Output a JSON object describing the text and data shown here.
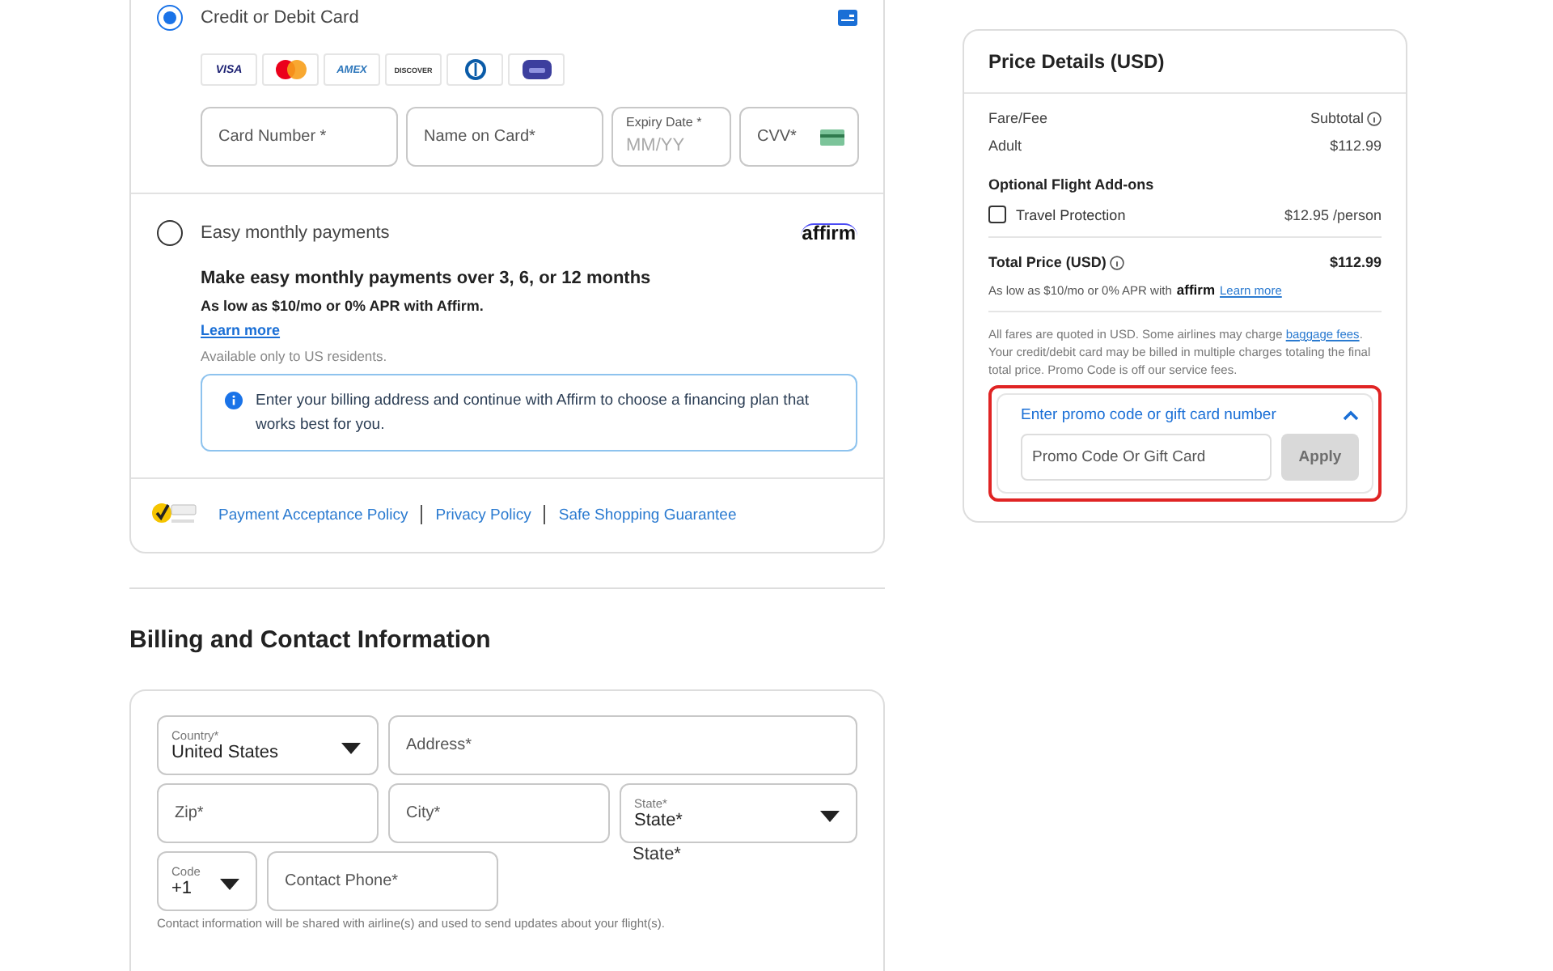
{
  "payment": {
    "methods": [
      {
        "kind": "card",
        "label": "Credit or Debit Card",
        "selected": true,
        "brands": [
          {
            "kind": "visa",
            "text": "VISA"
          },
          {
            "kind": "mastercard"
          },
          {
            "kind": "amex",
            "text": "AMEX"
          },
          {
            "kind": "discover",
            "text": "DISCOVER"
          },
          {
            "kind": "diners"
          },
          {
            "kind": "generic"
          }
        ],
        "fields": [
          {
            "kind": "plain",
            "placeholder": "Card Number *"
          },
          {
            "kind": "plain",
            "placeholder": "Name on Card*"
          },
          {
            "kind": "labeled",
            "label": "Expiry Date *",
            "placeholder": "MM/YY"
          },
          {
            "kind": "cvv",
            "placeholder": "CVV*"
          }
        ]
      },
      {
        "kind": "affirm",
        "label": "Easy monthly payments",
        "selected": false,
        "logo_text": "affirm",
        "heading": "Make easy monthly payments over 3, 6, or 12 months",
        "offer": "As low as **$10**/mo or 0% APR with Affirm.",
        "link": "Learn more",
        "note": "Available only to US residents.",
        "info": "Enter your billing address and continue with Affirm to choose a financing plan that works best for you."
      }
    ],
    "footer_links": [
      "Payment Acceptance Policy",
      "Privacy Policy",
      "Safe Shopping Guarantee"
    ]
  },
  "billing": {
    "title": "Billing and Contact Information",
    "rows": [
      [
        {
          "kind": "select",
          "label": "Country*",
          "value": "United States"
        },
        {
          "kind": "input",
          "placeholder": "Address*"
        }
      ],
      [
        {
          "kind": "input",
          "placeholder": "Zip*"
        },
        {
          "kind": "input",
          "placeholder": "City*"
        },
        {
          "kind": "select",
          "label": "State*",
          "value": "State*",
          "echo": "State*"
        }
      ],
      [
        {
          "kind": "select",
          "label": "Code",
          "value": "+1"
        },
        {
          "kind": "input",
          "placeholder": "Contact Phone*"
        }
      ]
    ],
    "note": "Contact information will be shared with airline(s) and used to send updates about your flight(s)."
  },
  "price": {
    "title": "Price Details (USD)",
    "header": {
      "label": "Fare/Fee",
      "value": "Subtotal"
    },
    "rows": [
      {
        "label": "Adult",
        "value": "$112.99"
      }
    ],
    "addons_title": "Optional Flight Add-ons",
    "addons": [
      {
        "label": "Travel Protection",
        "checked": false,
        "price": "$12.95 /person"
      }
    ],
    "total": {
      "label": "Total Price (USD)",
      "value": "$112.99"
    },
    "affirm_line": {
      "before": "As low as $10/mo or 0% APR with",
      "logo_text": "affirm",
      "link": "Learn more"
    },
    "disclaimer": {
      "before": "All fares are quoted in USD. Some airlines may charge",
      "link": "baggage fees",
      "after": ". Your credit/debit card may be billed in multiple charges totaling the final total price. Promo Code is off our service fees."
    },
    "promo": {
      "title": "Enter promo code or gift card number",
      "expanded": true,
      "highlighted": true,
      "placeholder": "Promo Code Or Gift Card",
      "button": "Apply",
      "button_disabled": true
    }
  }
}
